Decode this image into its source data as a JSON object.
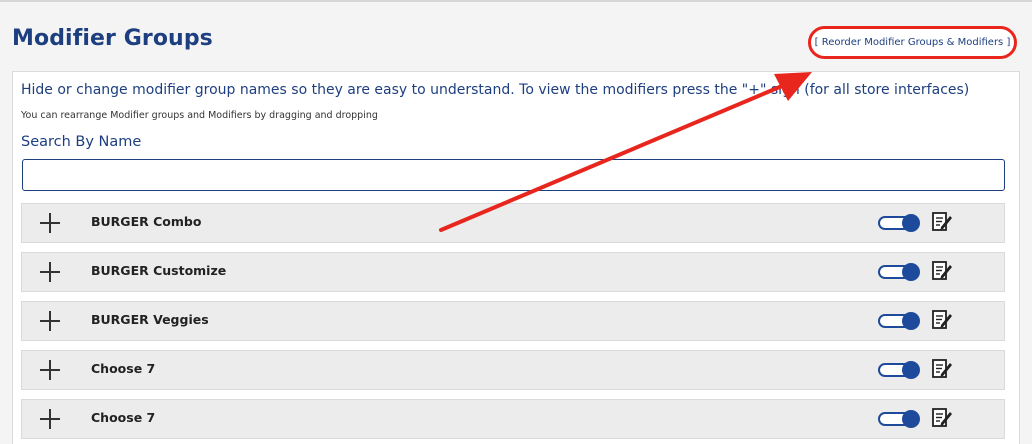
{
  "header": {
    "title": "Modifier Groups",
    "reorder_link": "[ Reorder Modifier Groups & Modifiers ]"
  },
  "intro": {
    "text": "Hide or change modifier group names so they are easy to understand. To view the modifiers press the \"+\" sign (for all store interfaces)",
    "hint": "You can rearrange Modifier groups and Modifiers by dragging and dropping"
  },
  "search": {
    "label": "Search By Name",
    "value": "",
    "placeholder": ""
  },
  "groups": [
    {
      "name": "BURGER Combo",
      "enabled": true
    },
    {
      "name": "BURGER Customize",
      "enabled": true
    },
    {
      "name": "BURGER Veggies",
      "enabled": true
    },
    {
      "name": "Choose 7",
      "enabled": true
    },
    {
      "name": "Choose 7",
      "enabled": true
    }
  ],
  "colors": {
    "brand": "#1d3f80",
    "toggle": "#1d4a9a",
    "highlight": "#e8261d"
  }
}
